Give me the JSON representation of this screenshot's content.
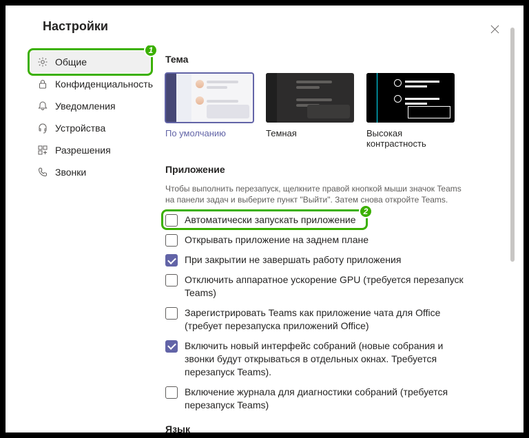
{
  "title": "Настройки",
  "sidebar": {
    "items": [
      {
        "label": "Общие"
      },
      {
        "label": "Конфиденциальность"
      },
      {
        "label": "Уведомления"
      },
      {
        "label": "Устройства"
      },
      {
        "label": "Разрешения"
      },
      {
        "label": "Звонки"
      }
    ]
  },
  "theme": {
    "heading": "Тема",
    "options": [
      {
        "label": "По умолчанию"
      },
      {
        "label": "Темная"
      },
      {
        "label": "Высокая контрастность"
      }
    ]
  },
  "app": {
    "heading": "Приложение",
    "desc": "Чтобы выполнить перезапуск, щелкните правой кнопкой мыши значок Teams на панели задач и выберите пункт \"Выйти\". Затем снова откройте Teams.",
    "checks": [
      {
        "label": "Автоматически запускать приложение",
        "checked": false
      },
      {
        "label": "Открывать приложение на заднем плане",
        "checked": false
      },
      {
        "label": "При закрытии не завершать работу приложения",
        "checked": true
      },
      {
        "label": "Отключить аппаратное ускорение GPU (требуется перезапуск Teams)",
        "checked": false
      },
      {
        "label": "Зарегистрировать Teams как приложение чата для Office (требует перезапуска приложений Office)",
        "checked": false
      },
      {
        "label": "Включить новый интерфейс собраний (новые собрания и звонки будут открываться в отдельных окнах. Требуется перезапуск Teams).",
        "checked": true
      },
      {
        "label": "Включение журнала для диагностики собраний (требуется перезапуск Teams)",
        "checked": false
      }
    ]
  },
  "lang": {
    "heading": "Язык"
  },
  "annotations": {
    "one": "1",
    "two": "2"
  }
}
